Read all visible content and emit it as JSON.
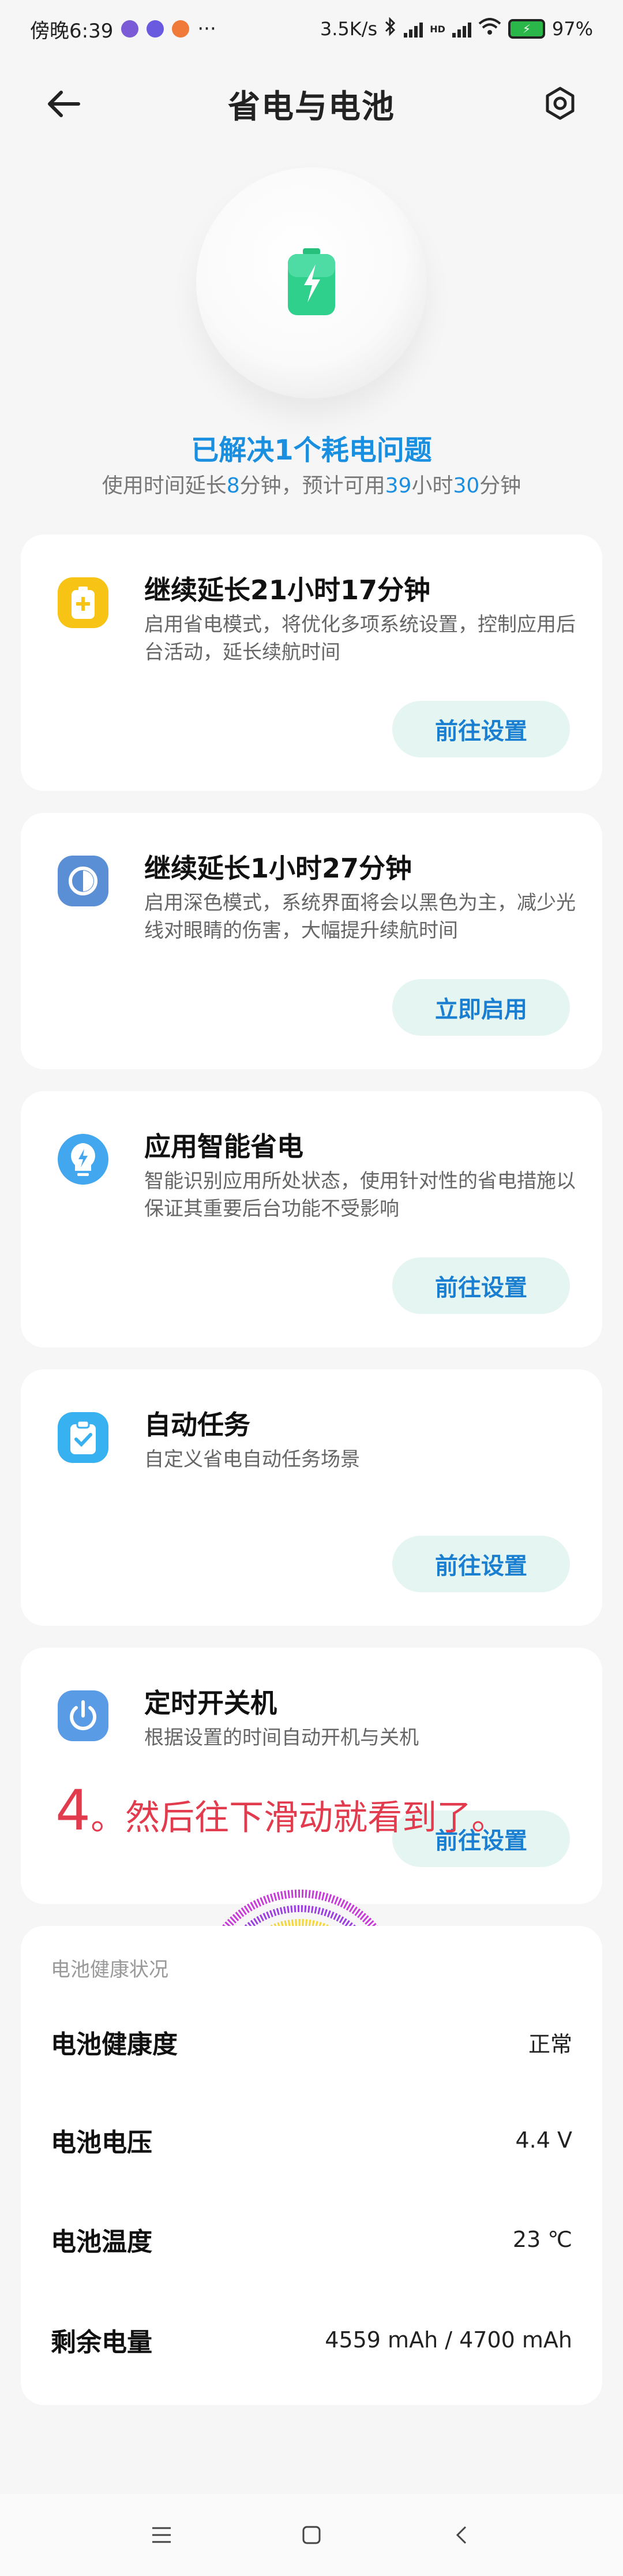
{
  "status_bar": {
    "time": "傍晚6:39",
    "more": "···",
    "net_speed": "3.5K/s",
    "hd": "HD",
    "battery_percent": "97%"
  },
  "header": {
    "title": "省电与电池",
    "back_icon": "back-arrow-icon",
    "settings_icon": "gear-icon"
  },
  "summary": {
    "solved": "已解决1个耗电问题",
    "extend_prefix": "使用时间延长",
    "extend_min": "8",
    "extend_mid": "分钟，预计可用",
    "remaining_hours": "39",
    "hours_unit": "小时",
    "remaining_minutes": "30",
    "minutes_unit": "分钟"
  },
  "cards": [
    {
      "title": "继续延长21小时17分钟",
      "desc": "启用省电模式，将优化多项系统设置，控制应用后台活动，延长续航时间",
      "button": "前往设置",
      "icon": "battery-saver-icon",
      "color": "#f7c315"
    },
    {
      "title": "继续延长1小时27分钟",
      "desc": "启用深色模式，系统界面将会以黑色为主，减少光线对眼睛的伤害，大幅提升续航时间",
      "button": "立即启用",
      "icon": "dark-mode-icon",
      "color": "#5a8fd6"
    },
    {
      "title": "应用智能省电",
      "desc": "智能识别应用所处状态，使用针对性的省电措施以保证其重要后台功能不受影响",
      "button": "前往设置",
      "icon": "smart-saver-icon",
      "color": "#43a7f0"
    },
    {
      "title": "自动任务",
      "desc": "自定义省电自动任务场景",
      "button": "前往设置",
      "icon": "auto-task-icon",
      "color": "#37b1ef"
    },
    {
      "title": "定时开关机",
      "desc": "根据设置的时间自动开机与关机",
      "button": "前往设置",
      "icon": "power-schedule-icon",
      "color": "#5a9be6"
    }
  ],
  "annotation": {
    "number": "4",
    "text": "。然后往下滑动就看到了。"
  },
  "battery_health": {
    "section_title": "电池健康状况",
    "rows": [
      {
        "label": "电池健康度",
        "value": "正常"
      },
      {
        "label": "电池电压",
        "value": "4.4 V"
      },
      {
        "label": "电池温度",
        "value": "23 ℃"
      },
      {
        "label": "剩余电量",
        "value": "4559 mAh / 4700 mAh"
      }
    ]
  },
  "nav": {
    "menu_icon": "menu-icon",
    "home_icon": "home-icon",
    "back_icon": "back-chevron-icon"
  },
  "colors": {
    "accent_blue": "#1a8fe0",
    "button_bg": "#e5f6f2",
    "annotation_red": "#e23b4e",
    "battery_green": "#2bb64a"
  }
}
